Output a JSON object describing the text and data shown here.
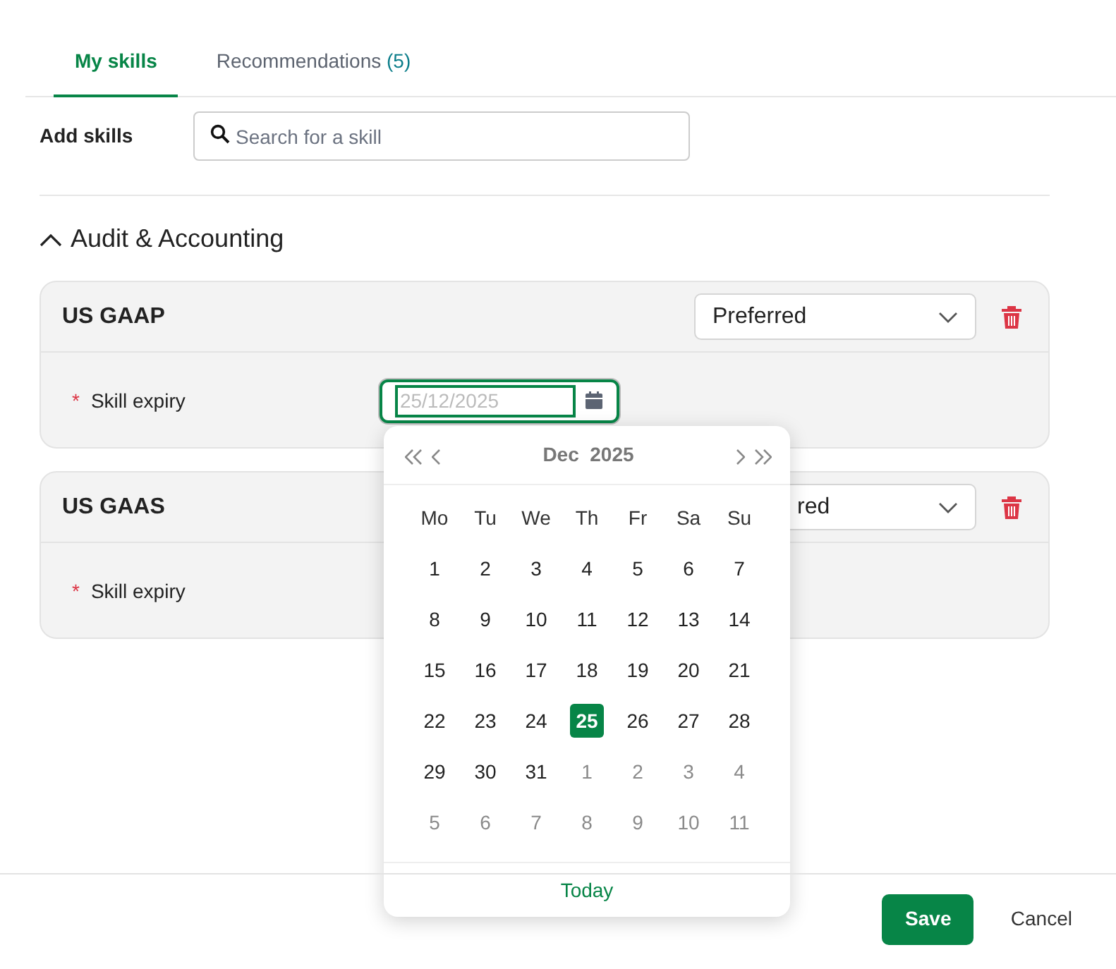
{
  "tabs": [
    {
      "label": "My skills",
      "selected": true
    },
    {
      "label": "Recommendations",
      "count": "(5)",
      "selected": false
    }
  ],
  "add_skills": {
    "label": "Add skills",
    "placeholder": "Search for a skill"
  },
  "section": {
    "title": "Audit & Accounting",
    "expanded": true
  },
  "skills": [
    {
      "name": "US GAAP",
      "level": "Preferred",
      "required_mark": "*",
      "expiry_label": "Skill expiry",
      "expiry_placeholder": "25/12/2025",
      "focused": true
    },
    {
      "name": "US GAAS",
      "level": "red",
      "required_mark": "*",
      "expiry_label": "Skill expiry"
    }
  ],
  "datepicker": {
    "month": "Dec",
    "year": "2025",
    "weekdays": [
      "Mo",
      "Tu",
      "We",
      "Th",
      "Fr",
      "Sa",
      "Su"
    ],
    "weeks": [
      [
        {
          "day": "1",
          "other_month": false,
          "selected": false
        },
        {
          "day": "2",
          "other_month": false,
          "selected": false
        },
        {
          "day": "3",
          "other_month": false,
          "selected": false
        },
        {
          "day": "4",
          "other_month": false,
          "selected": false
        },
        {
          "day": "5",
          "other_month": false,
          "selected": false
        },
        {
          "day": "6",
          "other_month": false,
          "selected": false
        },
        {
          "day": "7",
          "other_month": false,
          "selected": false
        }
      ],
      [
        {
          "day": "8",
          "other_month": false,
          "selected": false
        },
        {
          "day": "9",
          "other_month": false,
          "selected": false
        },
        {
          "day": "10",
          "other_month": false,
          "selected": false
        },
        {
          "day": "11",
          "other_month": false,
          "selected": false
        },
        {
          "day": "12",
          "other_month": false,
          "selected": false
        },
        {
          "day": "13",
          "other_month": false,
          "selected": false
        },
        {
          "day": "14",
          "other_month": false,
          "selected": false
        }
      ],
      [
        {
          "day": "15",
          "other_month": false,
          "selected": false
        },
        {
          "day": "16",
          "other_month": false,
          "selected": false
        },
        {
          "day": "17",
          "other_month": false,
          "selected": false
        },
        {
          "day": "18",
          "other_month": false,
          "selected": false
        },
        {
          "day": "19",
          "other_month": false,
          "selected": false
        },
        {
          "day": "20",
          "other_month": false,
          "selected": false
        },
        {
          "day": "21",
          "other_month": false,
          "selected": false
        }
      ],
      [
        {
          "day": "22",
          "other_month": false,
          "selected": false
        },
        {
          "day": "23",
          "other_month": false,
          "selected": false
        },
        {
          "day": "24",
          "other_month": false,
          "selected": false
        },
        {
          "day": "25",
          "other_month": false,
          "selected": true
        },
        {
          "day": "26",
          "other_month": false,
          "selected": false
        },
        {
          "day": "27",
          "other_month": false,
          "selected": false
        },
        {
          "day": "28",
          "other_month": false,
          "selected": false
        }
      ],
      [
        {
          "day": "29",
          "other_month": false,
          "selected": false
        },
        {
          "day": "30",
          "other_month": false,
          "selected": false
        },
        {
          "day": "31",
          "other_month": false,
          "selected": false
        },
        {
          "day": "1",
          "other_month": true,
          "selected": false
        },
        {
          "day": "2",
          "other_month": true,
          "selected": false
        },
        {
          "day": "3",
          "other_month": true,
          "selected": false
        },
        {
          "day": "4",
          "other_month": true,
          "selected": false
        }
      ],
      [
        {
          "day": "5",
          "other_month": true,
          "selected": false
        },
        {
          "day": "6",
          "other_month": true,
          "selected": false
        },
        {
          "day": "7",
          "other_month": true,
          "selected": false
        },
        {
          "day": "8",
          "other_month": true,
          "selected": false
        },
        {
          "day": "9",
          "other_month": true,
          "selected": false
        },
        {
          "day": "10",
          "other_month": true,
          "selected": false
        },
        {
          "day": "11",
          "other_month": true,
          "selected": false
        }
      ]
    ],
    "today_label": "Today"
  },
  "footer": {
    "save": "Save",
    "cancel": "Cancel"
  }
}
